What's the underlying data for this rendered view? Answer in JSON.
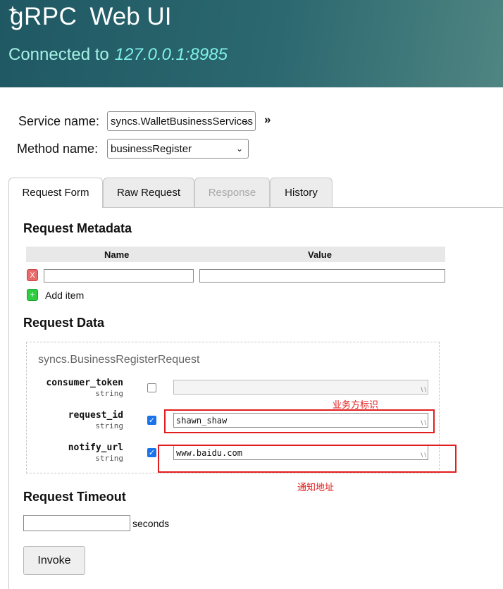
{
  "header": {
    "logo": "gRPC",
    "title": "Web UI",
    "connected_label": "Connected to",
    "address": "127.0.0.1:8985"
  },
  "service": {
    "label": "Service name:",
    "value": "syncs.WalletBusinessServices"
  },
  "method": {
    "label": "Method name:",
    "value": "businessRegister"
  },
  "expand_icon": "double-chevron-right-icon",
  "tabs": [
    {
      "label": "Request Form",
      "state": "active"
    },
    {
      "label": "Raw Request",
      "state": "normal"
    },
    {
      "label": "Response",
      "state": "disabled"
    },
    {
      "label": "History",
      "state": "normal"
    }
  ],
  "metadata": {
    "heading": "Request Metadata",
    "columns": [
      "Name",
      "Value"
    ],
    "remove_label": "X",
    "add_icon": "+",
    "add_label": "Add item"
  },
  "request_data": {
    "heading": "Request Data",
    "message_name": "syncs.BusinessRegisterRequest",
    "fields": [
      {
        "name": "consumer_token",
        "type": "string",
        "checked": false,
        "value": ""
      },
      {
        "name": "request_id",
        "type": "string",
        "checked": true,
        "value": "shawn_shaw"
      },
      {
        "name": "notify_url",
        "type": "string",
        "checked": true,
        "value": "www.baidu.com"
      }
    ],
    "annotations": [
      "业务方标识",
      "通知地址"
    ],
    "annotation_color": "#e21d1d"
  },
  "timeout": {
    "heading": "Request Timeout",
    "unit": "seconds",
    "value": ""
  },
  "invoke_label": "Invoke"
}
